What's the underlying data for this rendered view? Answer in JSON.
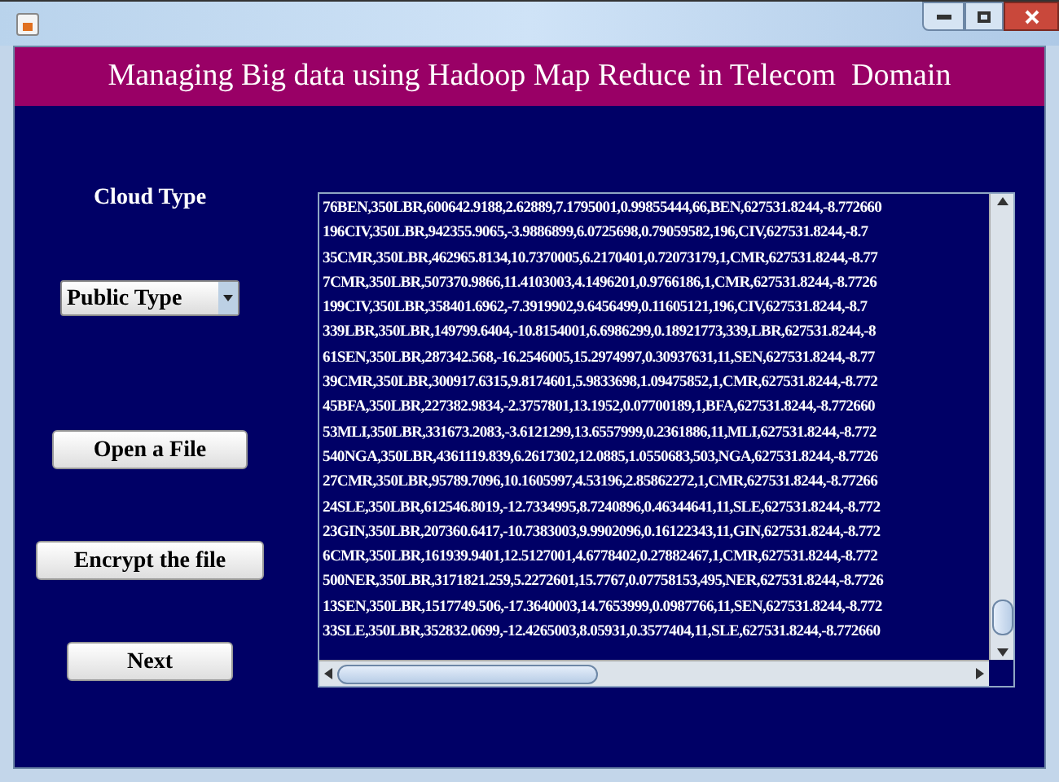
{
  "header": {
    "title": "Managing Big data using Hadoop Map Reduce in Telecom  Domain"
  },
  "cloud_type": {
    "label": "Cloud Type",
    "value": "Public Type"
  },
  "buttons": [
    "Open a File",
    "Encrypt the file",
    "Next"
  ],
  "records": [
    "76BEN,350LBR,600642.9188,2.62889,7.1795001,0.99855444,66,BEN,627531.8244,-8.772660",
    "196CIV,350LBR,942355.9065,-3.9886899,6.0725698,0.79059582,196,CIV,627531.8244,-8.7",
    "35CMR,350LBR,462965.8134,10.7370005,6.2170401,0.72073179,1,CMR,627531.8244,-8.77",
    "7CMR,350LBR,507370.9866,11.4103003,4.1496201,0.9766186,1,CMR,627531.8244,-8.7726",
    "199CIV,350LBR,358401.6962,-7.3919902,9.6456499,0.11605121,196,CIV,627531.8244,-8.7",
    "339LBR,350LBR,149799.6404,-10.8154001,6.6986299,0.18921773,339,LBR,627531.8244,-8",
    "61SEN,350LBR,287342.568,-16.2546005,15.2974997,0.30937631,11,SEN,627531.8244,-8.77",
    "39CMR,350LBR,300917.6315,9.8174601,5.9833698,1.09475852,1,CMR,627531.8244,-8.772",
    "45BFA,350LBR,227382.9834,-2.3757801,13.1952,0.07700189,1,BFA,627531.8244,-8.772660",
    "53MLI,350LBR,331673.2083,-3.6121299,13.6557999,0.2361886,11,MLI,627531.8244,-8.772",
    "540NGA,350LBR,4361119.839,6.2617302,12.0885,1.0550683,503,NGA,627531.8244,-8.7726",
    "27CMR,350LBR,95789.7096,10.1605997,4.53196,2.85862272,1,CMR,627531.8244,-8.77266",
    "24SLE,350LBR,612546.8019,-12.7334995,8.7240896,0.46344641,11,SLE,627531.8244,-8.772",
    "23GIN,350LBR,207360.6417,-10.7383003,9.9902096,0.16122343,11,GIN,627531.8244,-8.772",
    "6CMR,350LBR,161939.9401,12.5127001,4.6778402,0.27882467,1,CMR,627531.8244,-8.772",
    "500NER,350LBR,3171821.259,5.2272601,15.7767,0.07758153,495,NER,627531.8244,-8.7726",
    "13SEN,350LBR,1517749.506,-17.3640003,14.7653999,0.0987766,11,SEN,627531.8244,-8.772",
    "33SLE,350LBR,352832.0699,-12.4265003,8.05931,0.3577404,11,SLE,627531.8244,-8.772660"
  ]
}
